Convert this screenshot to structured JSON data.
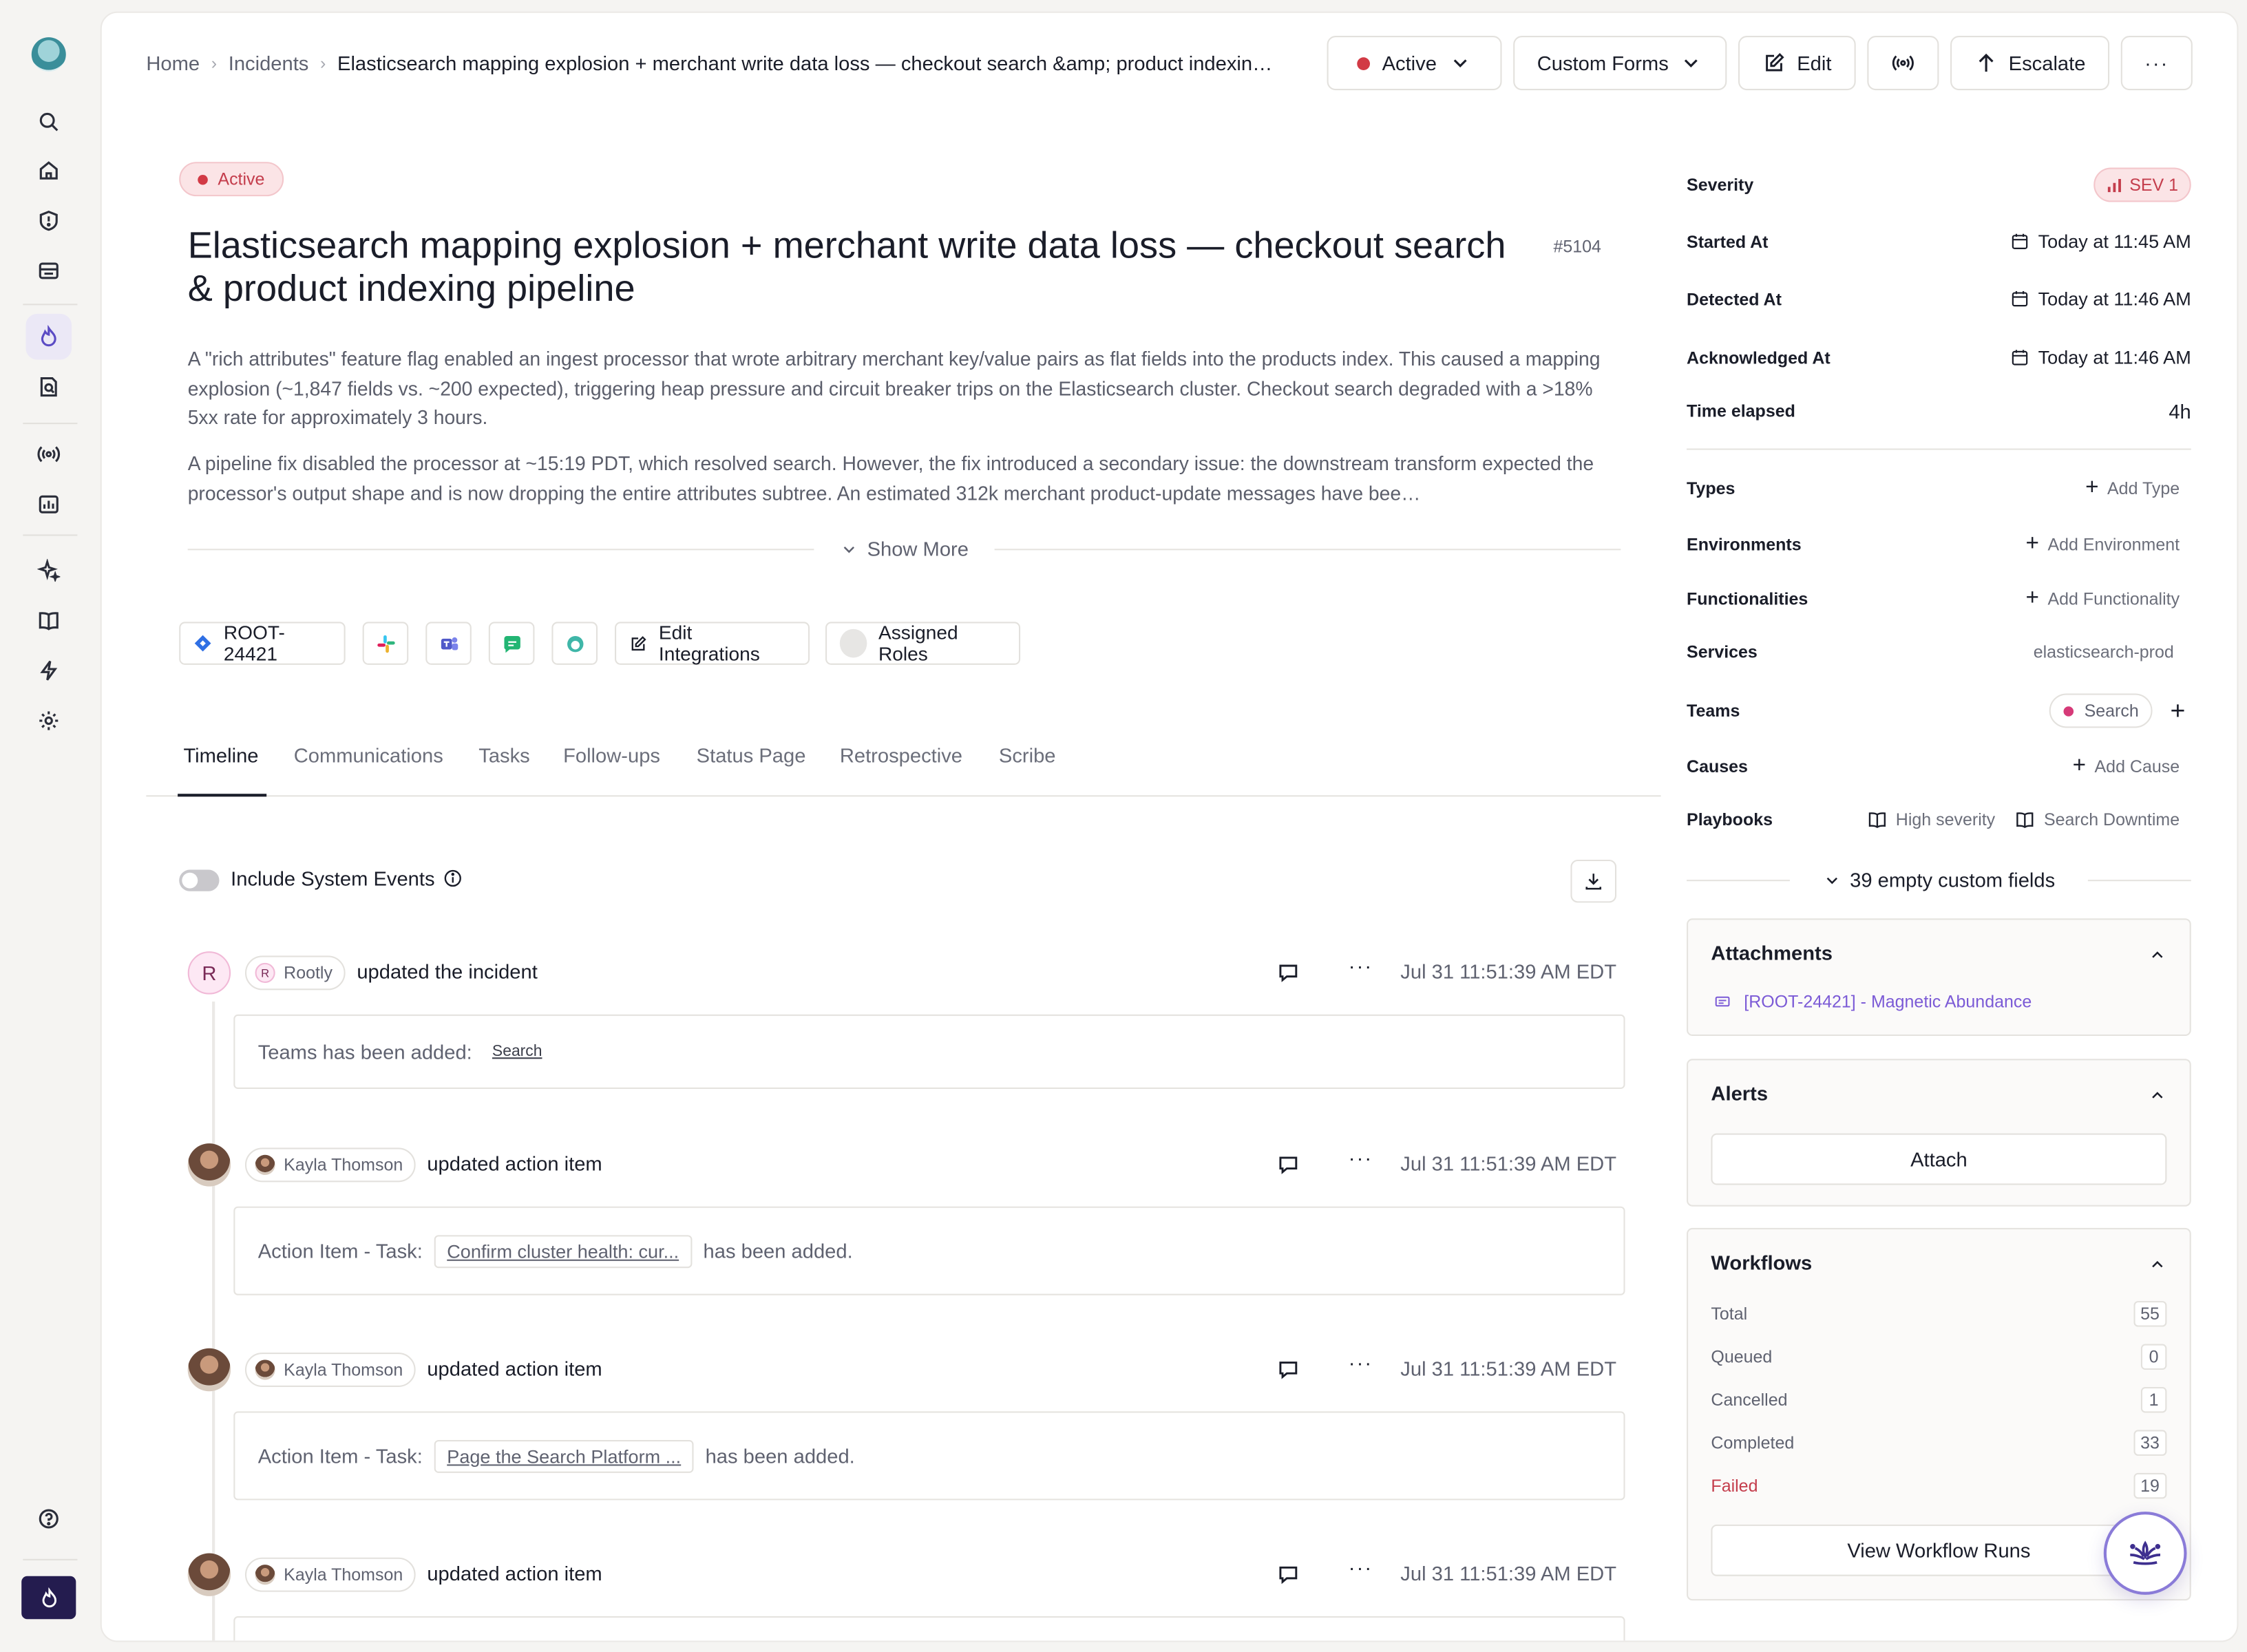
{
  "breadcrumb": {
    "home": "Home",
    "incidents": "Incidents",
    "current": "Elasticsearch mapping explosion + merchant write data loss — checkout search &amp; product indexing pipeline"
  },
  "toolbar": {
    "status_label": "Active",
    "custom_forms_label": "Custom Forms",
    "edit_label": "Edit",
    "escalate_label": "Escalate",
    "more_label": "···"
  },
  "incident": {
    "status": "Active",
    "title": "Elasticsearch mapping explosion + merchant write data loss — checkout search & product indexing pipeline",
    "number": "#5104",
    "description_p1": "A \"rich attributes\" feature flag enabled an ingest processor that wrote arbitrary merchant key/value pairs as flat fields into the products index. This caused a mapping explosion (~1,847 fields vs. ~200 expected), triggering heap pressure and circuit breaker trips on the Elasticsearch cluster. Checkout search degraded with a >18% 5xx rate for approximately 3 hours.",
    "description_p2": "A pipeline fix disabled the processor at ~15:19 PDT, which resolved search. However, the fix introduced a secondary issue: the downstream transform expected the processor's output shape and is now dropping the entire attributes subtree. An estimated 312k merchant product-update messages have bee…",
    "show_more": "Show More"
  },
  "integrations": {
    "jira_key": "ROOT-24421",
    "edit_integrations": "Edit Integrations",
    "assigned_roles": "Assigned Roles"
  },
  "tabs": [
    "Timeline",
    "Communications",
    "Tasks",
    "Follow-ups",
    "Status Page",
    "Retrospective",
    "Scribe"
  ],
  "timeline": {
    "include_system_events": "Include System Events",
    "events": [
      {
        "avatar_letter": "R",
        "actor_initial": "R",
        "actor": "Rootly",
        "action": "updated the incident",
        "time": "Jul 31 11:51:39 AM EDT",
        "body_prefix": "Teams has been added:",
        "body_link": "Search",
        "body_suffix": ""
      },
      {
        "actor": "Kayla Thomson",
        "action": "updated action item",
        "time": "Jul 31 11:51:39 AM EDT",
        "body_prefix": "Action Item - Task:",
        "body_link": "Confirm cluster health: cur...",
        "body_suffix": "has been added."
      },
      {
        "actor": "Kayla Thomson",
        "action": "updated action item",
        "time": "Jul 31 11:51:39 AM EDT",
        "body_prefix": "Action Item - Task:",
        "body_link": "Page the Search Platform ...",
        "body_suffix": "has been added."
      },
      {
        "actor": "Kayla Thomson",
        "action": "updated action item",
        "time": "Jul 31 11:51:39 AM EDT"
      }
    ]
  },
  "properties": {
    "severity_label": "Severity",
    "severity_value": "SEV 1",
    "started_label": "Started At",
    "started_value": "Today at 11:45 AM",
    "detected_label": "Detected At",
    "detected_value": "Today at 11:46 AM",
    "ack_label": "Acknowledged At",
    "ack_value": "Today at 11:46 AM",
    "elapsed_label": "Time elapsed",
    "elapsed_value": "4h",
    "types_label": "Types",
    "types_add": "Add Type",
    "env_label": "Environments",
    "env_add": "Add Environment",
    "func_label": "Functionalities",
    "func_add": "Add Functionality",
    "services_label": "Services",
    "services_value": "elasticsearch-prod",
    "teams_label": "Teams",
    "teams_value": "Search",
    "causes_label": "Causes",
    "causes_add": "Add Cause",
    "playbooks_label": "Playbooks",
    "playbook_1": "High severity",
    "playbook_2": "Search Downtime",
    "custom_fields": "39 empty custom fields"
  },
  "attachments": {
    "title": "Attachments",
    "item": "[ROOT-24421] - Magnetic Abundance"
  },
  "alerts": {
    "title": "Alerts",
    "attach_label": "Attach"
  },
  "workflows": {
    "title": "Workflows",
    "rows": [
      {
        "label": "Total",
        "count": "55"
      },
      {
        "label": "Queued",
        "count": "0"
      },
      {
        "label": "Cancelled",
        "count": "1"
      },
      {
        "label": "Completed",
        "count": "33"
      },
      {
        "label": "Failed",
        "count": "19"
      }
    ],
    "view_runs": "View Workflow Runs"
  },
  "colors": {
    "accent": "#241c4f",
    "danger": "#d23a45",
    "link": "#7b5ad6"
  }
}
